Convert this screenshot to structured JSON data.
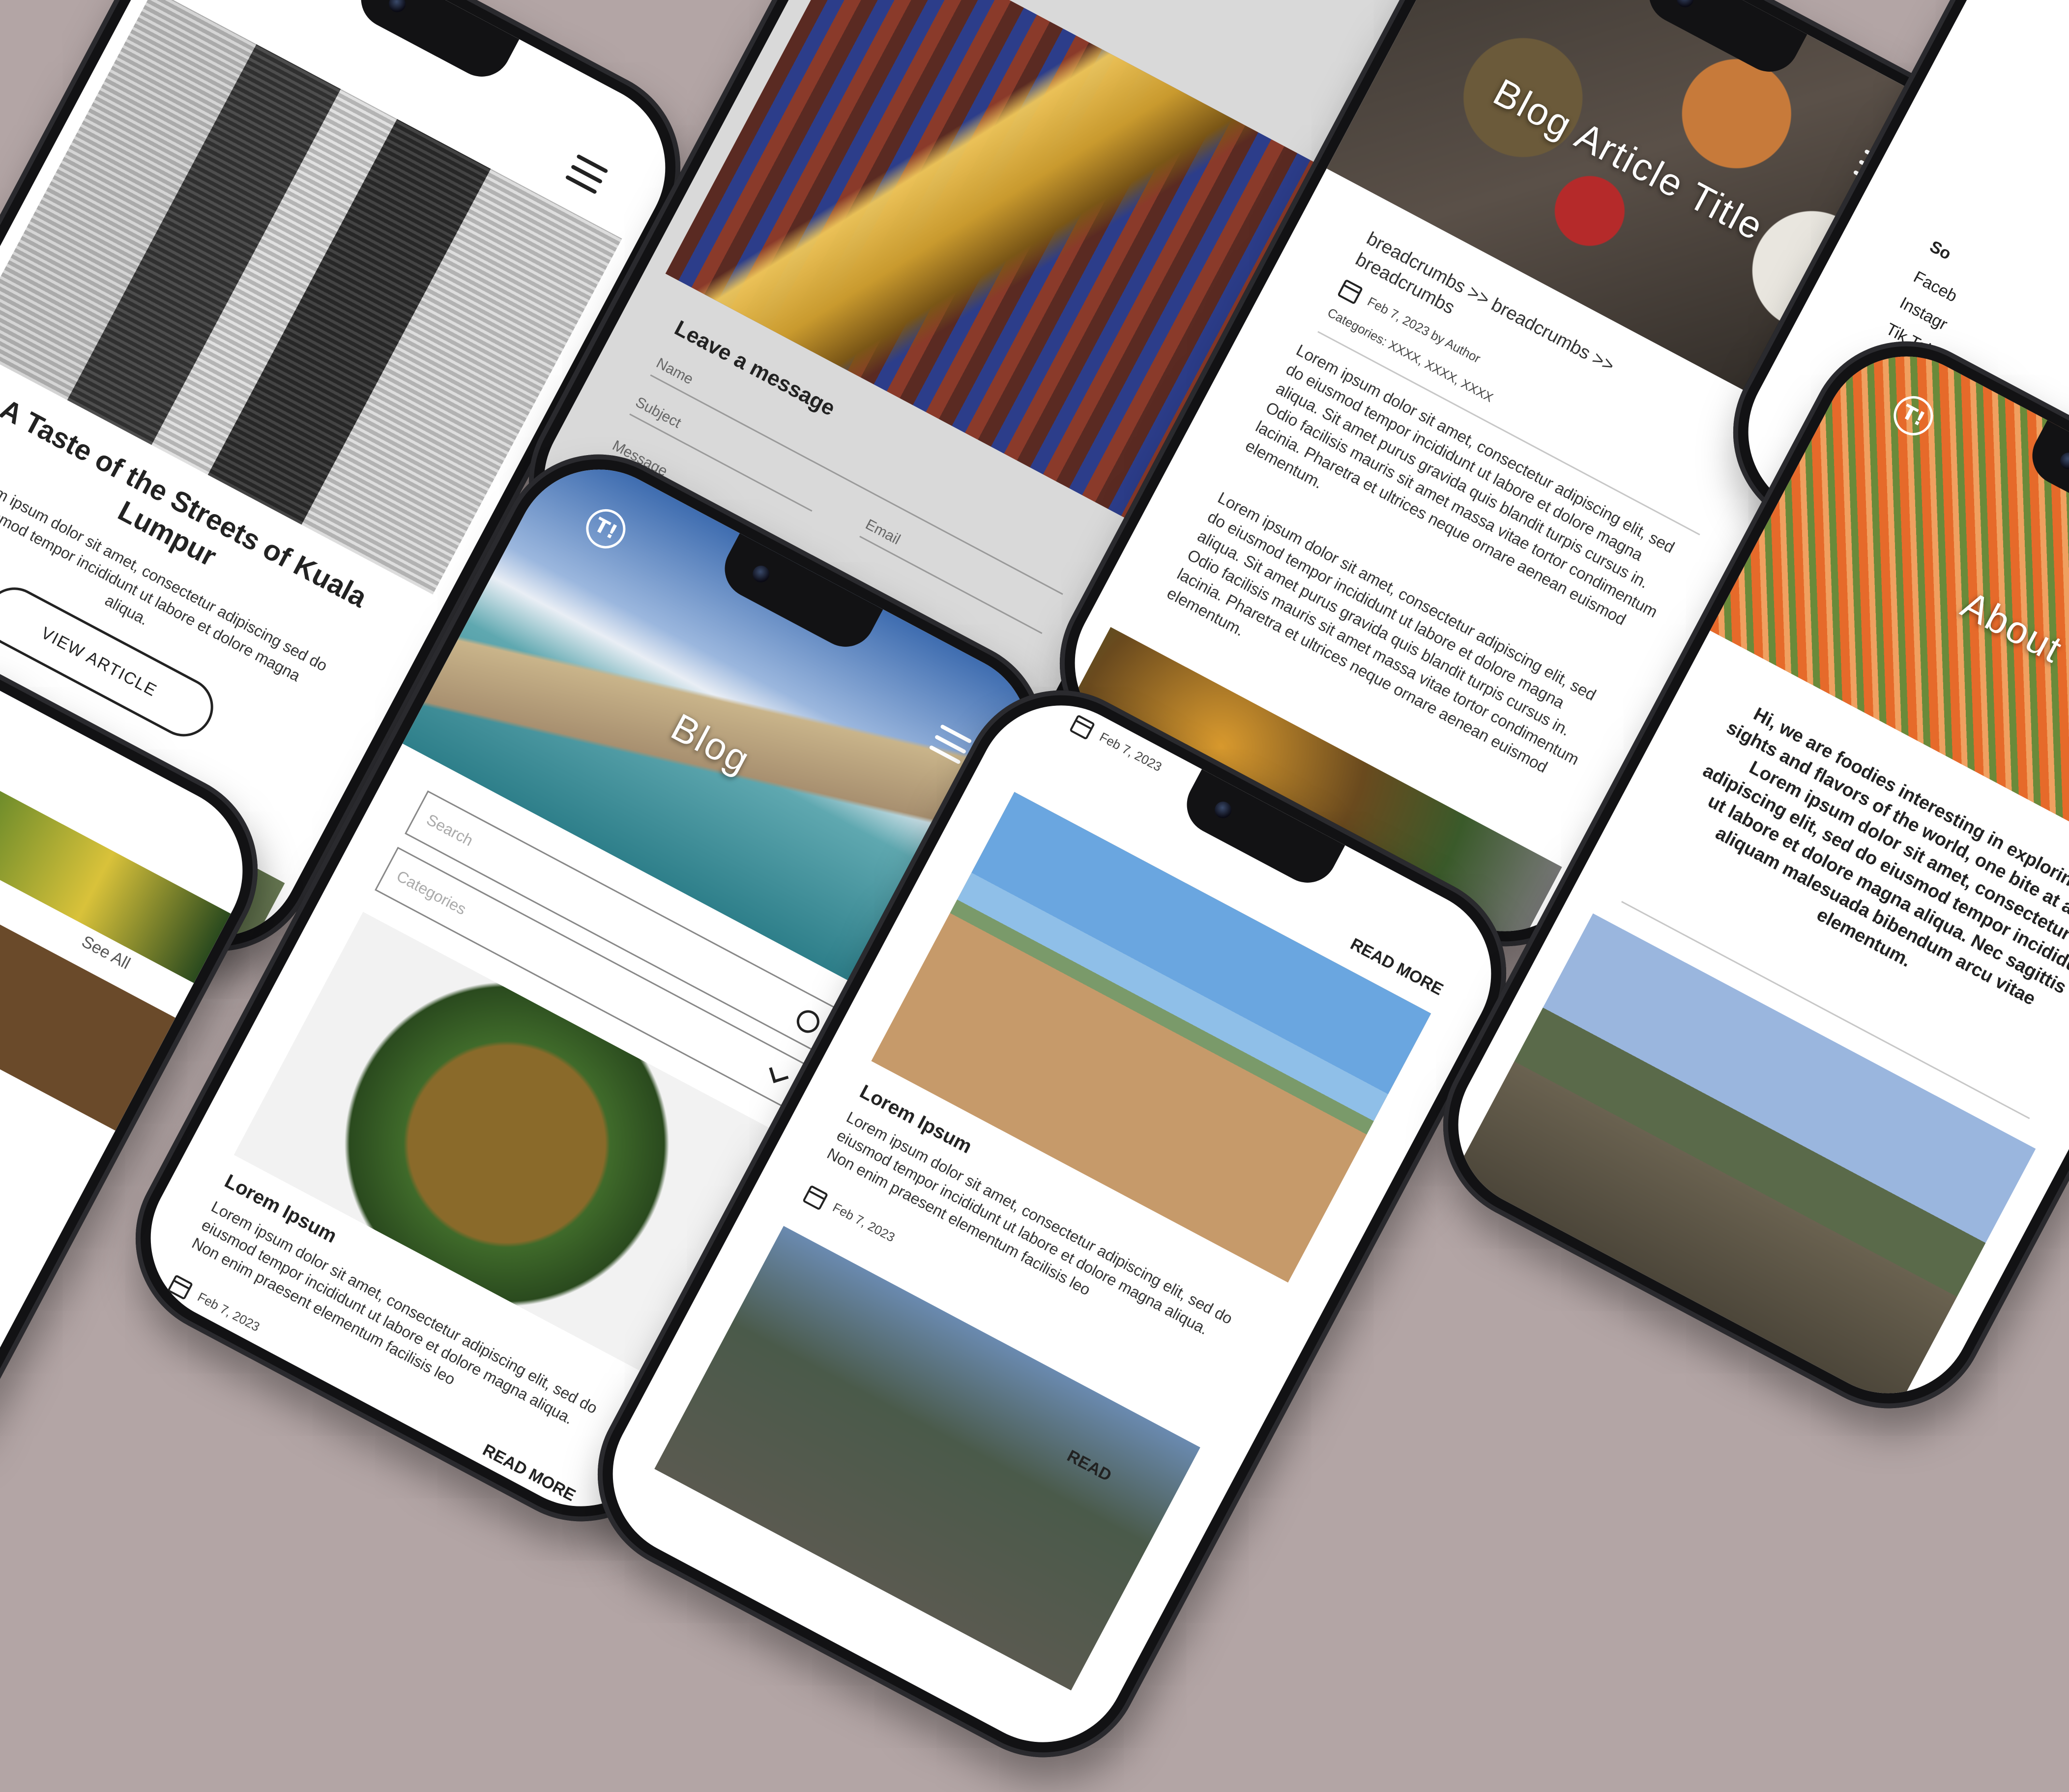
{
  "colors": {
    "background": "#b3a5a5",
    "phone_frame": "#121214",
    "blue_strip": "#7b9fe0"
  },
  "brand": {
    "logo_glyph": "T!"
  },
  "phone1": {
    "headline": "A Taste of the Streets of Kuala Lumpur",
    "excerpt": "Lorem ipsum dolor sit amet, consectetur adipiscing sed do eiusmod tempor incididunt ut labore et dolore magna aliqua.",
    "button": "VIEW ARTICLE",
    "section_fragment": "s",
    "see_all": "See All"
  },
  "phone2": {
    "form_title": "Leave a message",
    "name_label": "Name",
    "subject_label": "Subject",
    "email_label": "Email",
    "message_label": "Message"
  },
  "phone3": {
    "hero_title": "Blog Article Title",
    "breadcrumbs": "breadcrumbs >> breadcrumbs >> breadcrumbs",
    "date": "Feb 7, 2023",
    "author": "by Author",
    "categories": "Categories: XXXX, XXXX, XXXX",
    "paragraph_1": "Lorem ipsum dolor sit amet, consectetur adipiscing elit, sed do eiusmod tempor incididunt ut labore et dolore magna aliqua. Sit amet purus gravida quis blandit turpis cursus in. Odio facilisis mauris sit amet massa vitae tortor condimentum lacinia. Pharetra et ultrices neque ornare aenean euismod elementum.",
    "paragraph_2": "Lorem ipsum dolor sit amet, consectetur adipiscing elit, sed do eiusmod tempor incididunt ut labore et dolore magna aliqua. Sit amet purus gravida quis blandit turpis cursus in. Odio facilisis mauris sit amet massa vitae tortor condimentum lacinia. Pharetra et ultrices neque ornare aenean euismod elementum."
  },
  "phone4": {
    "social_heading_fragment": "So",
    "links": [
      "Faceb",
      "Instagr",
      "Tik Tok"
    ]
  },
  "phone5": {
    "hero_title": "Blog",
    "search_placeholder": "Search",
    "categories_placeholder": "Categories",
    "card_title": "Lorem Ipsum",
    "card_text": "Lorem ipsum dolor sit amet, consectetur adipiscing elit, sed do eiusmod tempor incididunt ut labore et dolore magna aliqua. Non enim praesent elementum facilisis leo",
    "card_date": "Feb 7, 2023",
    "read_more": "READ MORE"
  },
  "phone6": {
    "top_date": "Feb 7, 2023",
    "read_more_top": "READ MORE",
    "card_title": "Lorem Ipsum",
    "card_text": "Lorem ipsum dolor sit amet, consectetur adipiscing elit, sed do eiusmod tempor incididunt ut labore et dolore magna aliqua. Non enim praesent elementum facilisis leo",
    "card_date": "Feb 7, 2023",
    "read_more_bottom": "READ"
  },
  "phone7": {
    "hero_title": "About",
    "intro": "Hi, we are foodies interesting in exploring the sights and flavors of the world, one bite at a time. Lorem ipsum dolor sit amet, consectetur adipiscing elit, sed do eiusmod tempor incididunt ut labore et dolore magna aliqua. Nec sagittis aliquam malesuada bibendum arcu vitae elementum."
  },
  "phone8": {
    "see_all": "See All"
  }
}
